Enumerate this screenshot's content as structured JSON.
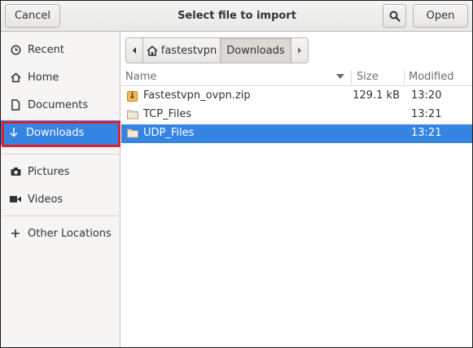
{
  "header": {
    "title": "Select file to import",
    "cancel_label": "Cancel",
    "open_label": "Open",
    "search_icon": "search-icon"
  },
  "sidebar": {
    "items": [
      {
        "label": "Recent",
        "icon": "clock-icon"
      },
      {
        "label": "Home",
        "icon": "home-icon"
      },
      {
        "label": "Documents",
        "icon": "document-icon"
      },
      {
        "label": "Downloads",
        "icon": "download-icon",
        "selected": true
      },
      {
        "label": "Pictures",
        "icon": "camera-icon"
      },
      {
        "label": "Videos",
        "icon": "video-icon"
      },
      {
        "label": "Other Locations",
        "icon": "plus-icon"
      }
    ]
  },
  "pathbar": {
    "home_label": "fastestvpn",
    "current_label": "Downloads"
  },
  "filelist": {
    "columns": {
      "name": "Name",
      "size": "Size",
      "modified": "Modified"
    },
    "rows": [
      {
        "name": "Fastestvpn_ovpn.zip",
        "size": "129.1 kB",
        "modified": "13:20",
        "icon": "archive-icon"
      },
      {
        "name": "TCP_Files",
        "size": "",
        "modified": "13:21",
        "icon": "folder-icon"
      },
      {
        "name": "UDP_Files",
        "size": "",
        "modified": "13:21",
        "icon": "folder-icon",
        "selected": true
      }
    ]
  },
  "colors": {
    "selection": "#3584e4",
    "highlight_outline": "#e0202d"
  }
}
